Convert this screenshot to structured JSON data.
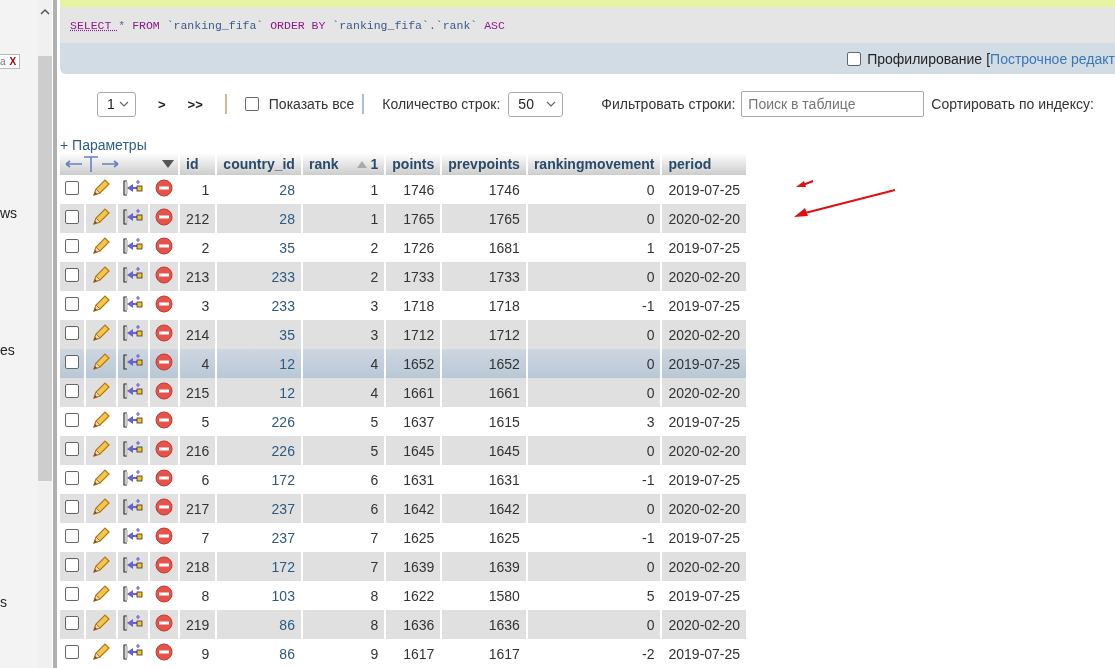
{
  "sidebar": {
    "filter_tag": {
      "text": "а",
      "close": "X"
    },
    "fragments": [
      "ws",
      "es",
      "s"
    ]
  },
  "sql": {
    "tokens": [
      {
        "kind": "keyword",
        "text": "SELECT"
      },
      {
        "kind": "operator",
        "text": "*"
      },
      {
        "kind": "keyword",
        "text": "FROM"
      },
      {
        "kind": "identifier",
        "text": "`ranking_fifa`"
      },
      {
        "kind": "keyword",
        "text": "ORDER BY"
      },
      {
        "kind": "identifier",
        "text": "`ranking_fifa`.`rank`"
      },
      {
        "kind": "keyword",
        "text": "ASC"
      }
    ]
  },
  "options_bar": {
    "profiling": {
      "label": "Профилирование",
      "checked": false
    },
    "bracket": "[",
    "link": "Построчное редакт"
  },
  "navigation": {
    "page": "1",
    "next": ">",
    "last": ">>",
    "show_all": {
      "label": "Показать все",
      "checked": false
    },
    "rows_label": "Количество строк:",
    "rows_value": "50",
    "filter_label": "Фильтровать строки:",
    "filter_placeholder": "Поиск в таблице",
    "sort_label": "Сортировать по индексу:"
  },
  "parameters_link": "+ Параметры",
  "table": {
    "columns": [
      {
        "label": "id"
      },
      {
        "label": "country_id"
      },
      {
        "label": "rank",
        "sort_order": "1"
      },
      {
        "label": "points"
      },
      {
        "label": "prevpoints"
      },
      {
        "label": "rankingmovement"
      },
      {
        "label": "period"
      }
    ],
    "rows": [
      {
        "selected": false,
        "cells": [
          "1",
          "28",
          "1",
          "1746",
          "1746",
          "0",
          "2019-07-25"
        ]
      },
      {
        "selected": false,
        "cells": [
          "212",
          "28",
          "1",
          "1765",
          "1765",
          "0",
          "2020-02-20"
        ]
      },
      {
        "selected": false,
        "cells": [
          "2",
          "35",
          "2",
          "1726",
          "1681",
          "1",
          "2019-07-25"
        ]
      },
      {
        "selected": false,
        "cells": [
          "213",
          "233",
          "2",
          "1733",
          "1733",
          "0",
          "2020-02-20"
        ]
      },
      {
        "selected": false,
        "cells": [
          "3",
          "233",
          "3",
          "1718",
          "1718",
          "-1",
          "2019-07-25"
        ]
      },
      {
        "selected": false,
        "cells": [
          "214",
          "35",
          "3",
          "1712",
          "1712",
          "0",
          "2020-02-20"
        ]
      },
      {
        "selected": true,
        "cells": [
          "4",
          "12",
          "4",
          "1652",
          "1652",
          "0",
          "2019-07-25"
        ]
      },
      {
        "selected": false,
        "cells": [
          "215",
          "12",
          "4",
          "1661",
          "1661",
          "0",
          "2020-02-20"
        ]
      },
      {
        "selected": false,
        "cells": [
          "5",
          "226",
          "5",
          "1637",
          "1615",
          "3",
          "2019-07-25"
        ]
      },
      {
        "selected": false,
        "cells": [
          "216",
          "226",
          "5",
          "1645",
          "1645",
          "0",
          "2020-02-20"
        ]
      },
      {
        "selected": false,
        "cells": [
          "6",
          "172",
          "6",
          "1631",
          "1631",
          "-1",
          "2019-07-25"
        ]
      },
      {
        "selected": false,
        "cells": [
          "217",
          "237",
          "6",
          "1642",
          "1642",
          "0",
          "2020-02-20"
        ]
      },
      {
        "selected": false,
        "cells": [
          "7",
          "237",
          "7",
          "1625",
          "1625",
          "-1",
          "2019-07-25"
        ]
      },
      {
        "selected": false,
        "cells": [
          "218",
          "172",
          "7",
          "1639",
          "1639",
          "0",
          "2020-02-20"
        ]
      },
      {
        "selected": false,
        "cells": [
          "8",
          "103",
          "8",
          "1622",
          "1580",
          "5",
          "2019-07-25"
        ]
      },
      {
        "selected": false,
        "cells": [
          "219",
          "86",
          "8",
          "1636",
          "1636",
          "0",
          "2020-02-20"
        ]
      },
      {
        "selected": false,
        "cells": [
          "9",
          "86",
          "9",
          "1617",
          "1617",
          "-2",
          "2019-07-25"
        ]
      }
    ]
  }
}
